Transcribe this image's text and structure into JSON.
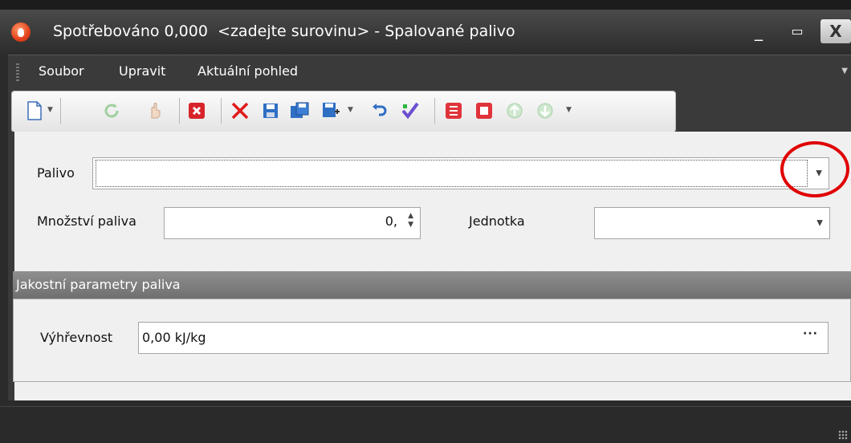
{
  "window": {
    "title": "Spotřebováno 0,000  <zadejte surovinu> - Spalované palivo",
    "controls": {
      "minimize": "_",
      "maximize": "▭",
      "close": "X"
    }
  },
  "menu": {
    "items": [
      "Soubor",
      "Upravit",
      "Aktuální pohled"
    ]
  },
  "toolbar": {
    "buttons": [
      "new-document-icon",
      "refresh-icon",
      "hand-icon",
      "delete-record-icon",
      "delete-icon",
      "save-icon",
      "save-copy-icon",
      "save-as-icon",
      "undo-icon",
      "validate-icon",
      "first-record-icon",
      "last-record-icon",
      "up-icon",
      "down-icon"
    ]
  },
  "form": {
    "palivo": {
      "label": "Palivo",
      "value": ""
    },
    "mnozstvi": {
      "label": "Množství paliva",
      "value": "0,"
    },
    "jednotka": {
      "label": "Jednotka",
      "value": ""
    },
    "group": {
      "title": "Jakostní parametry paliva",
      "vyhrevnost": {
        "label": "Výhřevnost",
        "value": "0,00 kJ/kg",
        "button": "···"
      }
    }
  },
  "colors": {
    "accent_highlight": "#e00000",
    "title_bar": "#3a3a3a"
  }
}
